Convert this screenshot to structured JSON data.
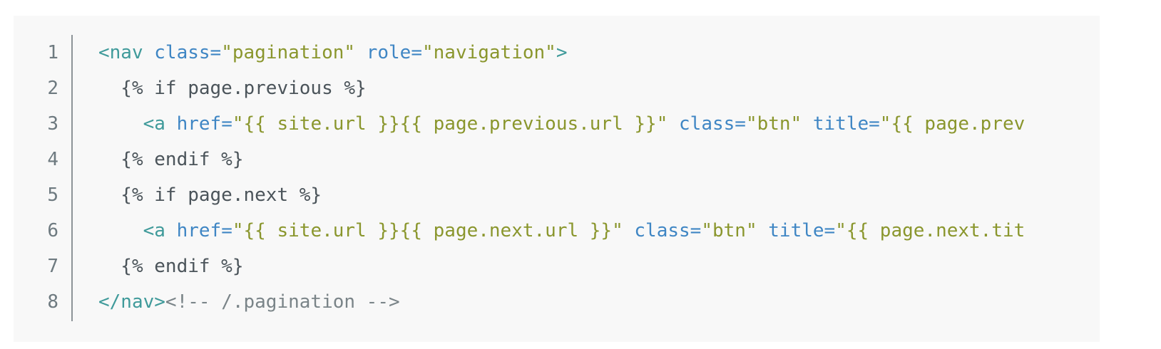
{
  "line_numbers": [
    "1",
    "2",
    "3",
    "4",
    "5",
    "6",
    "7",
    "8"
  ],
  "lines": [
    [
      {
        "type": "tag",
        "text": "<nav "
      },
      {
        "type": "attr",
        "text": "class="
      },
      {
        "type": "str",
        "text": "\"pagination\""
      },
      {
        "type": "text",
        "text": " "
      },
      {
        "type": "attr",
        "text": "role="
      },
      {
        "type": "str",
        "text": "\"navigation\""
      },
      {
        "type": "tag",
        "text": ">"
      }
    ],
    [
      {
        "type": "text",
        "text": "  {% if page.previous %}"
      }
    ],
    [
      {
        "type": "text",
        "text": "    "
      },
      {
        "type": "tag",
        "text": "<a "
      },
      {
        "type": "attr",
        "text": "href="
      },
      {
        "type": "str",
        "text": "\"{{ site.url }}{{ page.previous.url }}\""
      },
      {
        "type": "text",
        "text": " "
      },
      {
        "type": "attr",
        "text": "class="
      },
      {
        "type": "str",
        "text": "\"btn\""
      },
      {
        "type": "text",
        "text": " "
      },
      {
        "type": "attr",
        "text": "title="
      },
      {
        "type": "str",
        "text": "\"{{ page.prev"
      }
    ],
    [
      {
        "type": "text",
        "text": "  {% endif %}"
      }
    ],
    [
      {
        "type": "text",
        "text": "  {% if page.next %}"
      }
    ],
    [
      {
        "type": "text",
        "text": "    "
      },
      {
        "type": "tag",
        "text": "<a "
      },
      {
        "type": "attr",
        "text": "href="
      },
      {
        "type": "str",
        "text": "\"{{ site.url }}{{ page.next.url }}\""
      },
      {
        "type": "text",
        "text": " "
      },
      {
        "type": "attr",
        "text": "class="
      },
      {
        "type": "str",
        "text": "\"btn\""
      },
      {
        "type": "text",
        "text": " "
      },
      {
        "type": "attr",
        "text": "title="
      },
      {
        "type": "str",
        "text": "\"{{ page.next.tit"
      }
    ],
    [
      {
        "type": "text",
        "text": "  {% endif %}"
      }
    ],
    [
      {
        "type": "tag",
        "text": "</nav>"
      },
      {
        "type": "cmt",
        "text": "<!-- /.pagination -->"
      }
    ]
  ]
}
